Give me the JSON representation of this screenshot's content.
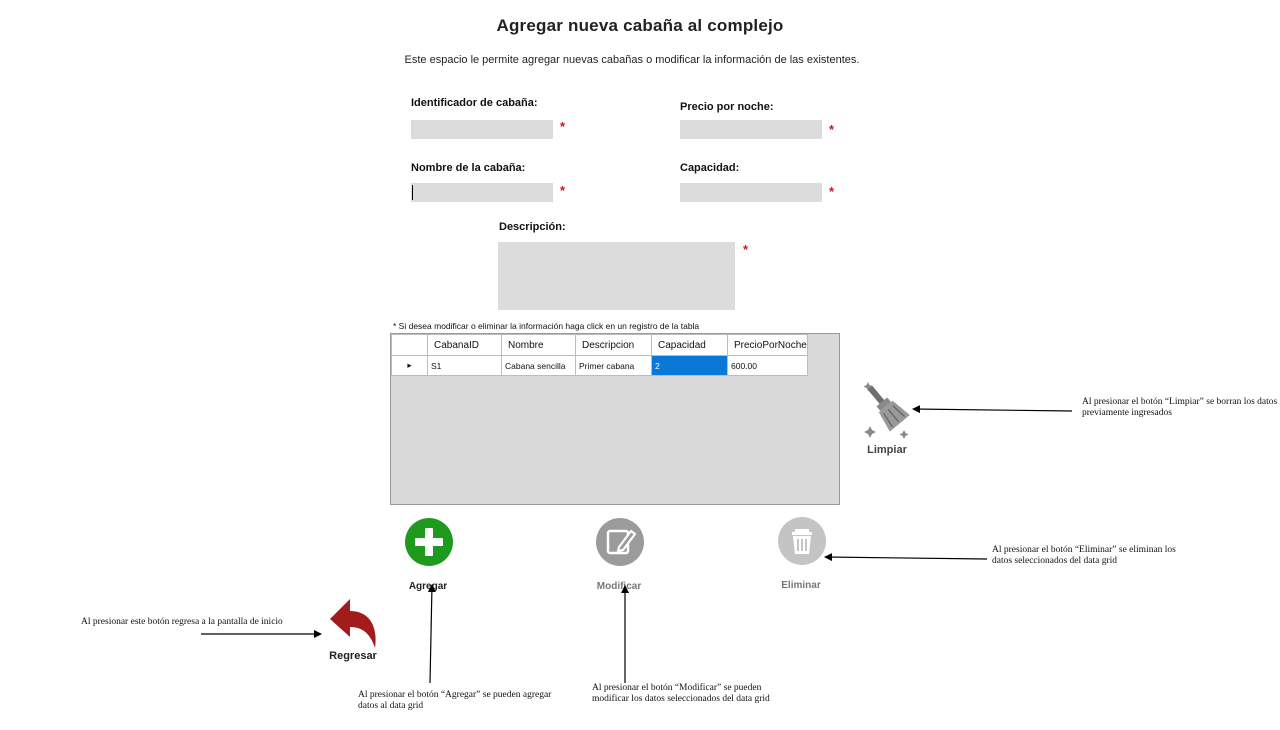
{
  "header": {
    "title": "Agregar nueva cabaña al complejo",
    "subtitle": "Este espacio le permite agregar nuevas cabañas o modificar la información de las existentes."
  },
  "form": {
    "id_label": "Identificador de cabaña:",
    "id_value": "",
    "price_label": "Precio por noche:",
    "price_value": "",
    "name_label": "Nombre de la cabaña:",
    "name_value": "",
    "capacity_label": "Capacidad:",
    "capacity_value": "",
    "description_label": "Descripción:",
    "description_value": "",
    "required_mark": "*"
  },
  "grid": {
    "note": "* Si desea modificar o eliminar la información haga click en un registro de la tabla",
    "row_indicator": "▸",
    "columns": [
      "CabanaID",
      "Nombre",
      "Descripcion",
      "Capacidad",
      "PrecioPorNoche"
    ],
    "rows": [
      [
        "S1",
        "Cabana sencilla",
        "Primer cabana",
        "2",
        "600.00"
      ]
    ],
    "selected_cell": {
      "row": 0,
      "column": 3
    }
  },
  "buttons": {
    "add": "Agregar",
    "modify": "Modificar",
    "delete": "Eliminar",
    "clear": "Limpiar",
    "back": "Regresar"
  },
  "annotations": {
    "clear": "Al presionar el botón “Limpiar” se borran los datos previamente ingresados",
    "delete": "Al presionar el botón “Eliminar” se eliminan los datos seleccionados del data grid",
    "back": "Al presionar este botón regresa a la pantalla de inicio",
    "add": "Al presionar el botón “Agregar” se pueden agregar datos al data grid",
    "modify": "Al presionar el botón “Modificar” se pueden modificar los datos seleccionados del data grid"
  },
  "colors": {
    "add": "#1e9a1e",
    "modify": "#9b9b9b",
    "delete": "#c4c4c4",
    "back": "#a31c1c",
    "required": "#d4141f",
    "selection": "#0a78d7",
    "field": "#dcdcdc"
  },
  "icons": {
    "add": "plus-circle-icon",
    "modify": "edit-pencil-icon",
    "delete": "trash-icon",
    "clear": "broom-icon",
    "back": "undo-arrow-icon"
  }
}
